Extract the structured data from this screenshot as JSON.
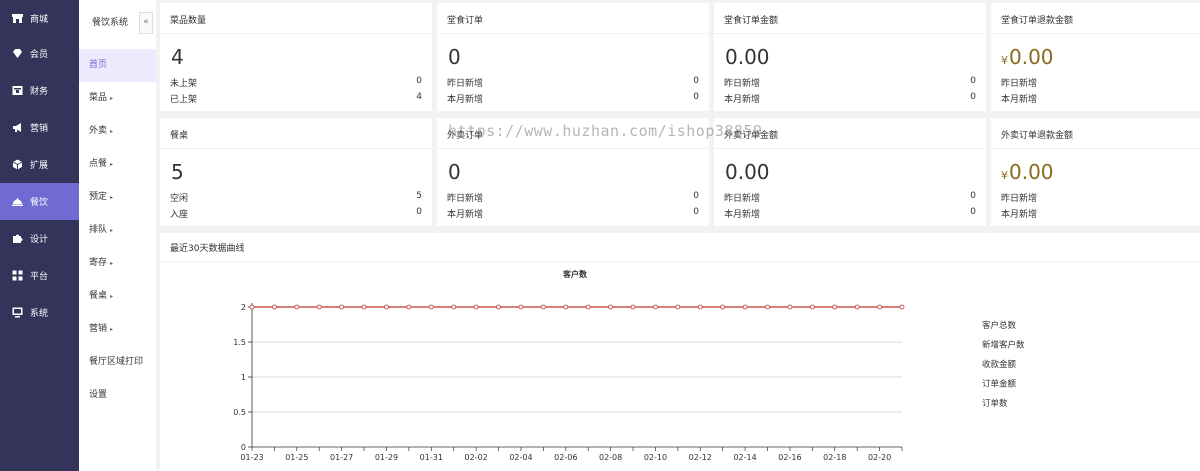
{
  "sidebar": {
    "items": [
      {
        "label": "商城",
        "icon": "store-icon"
      },
      {
        "label": "会员",
        "icon": "member-icon"
      },
      {
        "label": "财务",
        "icon": "finance-icon"
      },
      {
        "label": "营销",
        "icon": "megaphone-icon"
      },
      {
        "label": "扩展",
        "icon": "cube-icon"
      },
      {
        "label": "餐饮",
        "icon": "dish-cover-icon",
        "active": true
      },
      {
        "label": "设计",
        "icon": "puzzle-icon"
      },
      {
        "label": "平台",
        "icon": "grid-icon"
      },
      {
        "label": "系统",
        "icon": "monitor-icon"
      }
    ]
  },
  "submenu": {
    "title": "餐饮系统",
    "collapse": "«",
    "items": [
      {
        "label": "首页",
        "arrow": ""
      },
      {
        "label": "菜品",
        "arrow": "▸"
      },
      {
        "label": "外卖",
        "arrow": "▸"
      },
      {
        "label": "点餐",
        "arrow": "▸"
      },
      {
        "label": "预定",
        "arrow": "▸"
      },
      {
        "label": "排队",
        "arrow": "▸"
      },
      {
        "label": "寄存",
        "arrow": "▸"
      },
      {
        "label": "餐桌",
        "arrow": "▸"
      },
      {
        "label": "营销",
        "arrow": "▸"
      },
      {
        "label": "餐厅区域打印",
        "arrow": ""
      },
      {
        "label": "设置",
        "arrow": ""
      }
    ]
  },
  "cards": [
    {
      "title": "菜品数量",
      "value": "4",
      "currency": "",
      "rows": [
        {
          "label": "未上架",
          "value": "0"
        },
        {
          "label": "已上架",
          "value": "4"
        }
      ]
    },
    {
      "title": "堂食订单",
      "value": "0",
      "currency": "",
      "rows": [
        {
          "label": "昨日新增",
          "value": "0"
        },
        {
          "label": "本月新增",
          "value": "0"
        }
      ]
    },
    {
      "title": "堂食订单金额",
      "value": "0.00",
      "currency": "",
      "rows": [
        {
          "label": "昨日新增",
          "value": "0"
        },
        {
          "label": "本月新增",
          "value": "0"
        }
      ]
    },
    {
      "title": "堂食订单退款金额",
      "value": "0.00",
      "currency": "¥",
      "rows": [
        {
          "label": "昨日新增",
          "value": ""
        },
        {
          "label": "本月新增",
          "value": ""
        }
      ]
    },
    {
      "title": "餐桌",
      "value": "5",
      "currency": "",
      "rows": [
        {
          "label": "空闲",
          "value": "5"
        },
        {
          "label": "入座",
          "value": "0"
        }
      ]
    },
    {
      "title": "外卖订单",
      "value": "0",
      "currency": "",
      "rows": [
        {
          "label": "昨日新增",
          "value": "0"
        },
        {
          "label": "本月新增",
          "value": "0"
        }
      ]
    },
    {
      "title": "外卖订单金额",
      "value": "0.00",
      "currency": "",
      "rows": [
        {
          "label": "昨日新增",
          "value": "0"
        },
        {
          "label": "本月新增",
          "value": "0"
        }
      ]
    },
    {
      "title": "外卖订单退款金额",
      "value": "0.00",
      "currency": "¥",
      "rows": [
        {
          "label": "昨日新增",
          "value": ""
        },
        {
          "label": "本月新增",
          "value": ""
        }
      ]
    }
  ],
  "watermark": "https://www.huzhan.com/ishop38859",
  "chart_panel": {
    "title": "最近30天数据曲线"
  },
  "chart_data": {
    "type": "line",
    "title": "客户数",
    "x": [
      "01-23",
      "01-24",
      "01-25",
      "01-26",
      "01-27",
      "01-28",
      "01-29",
      "01-30",
      "01-31",
      "02-01",
      "02-02",
      "02-03",
      "02-04",
      "02-05",
      "02-06",
      "02-07",
      "02-08",
      "02-09",
      "02-10",
      "02-11",
      "02-12",
      "02-13",
      "02-14",
      "02-15",
      "02-16",
      "02-17",
      "02-18",
      "02-19",
      "02-20",
      "02-21"
    ],
    "x_tick_labels": [
      "01-23",
      "01-25",
      "01-27",
      "01-29",
      "01-31",
      "02-02",
      "02-04",
      "02-06",
      "02-08",
      "02-10",
      "02-12",
      "02-14",
      "02-16",
      "02-18",
      "02-20"
    ],
    "yticks": [
      "0",
      "0.5",
      "1",
      "1.5",
      "2"
    ],
    "ylim": [
      0,
      2
    ],
    "grid": true,
    "series": [
      {
        "name": "客户总数",
        "values": [
          2,
          2,
          2,
          2,
          2,
          2,
          2,
          2,
          2,
          2,
          2,
          2,
          2,
          2,
          2,
          2,
          2,
          2,
          2,
          2,
          2,
          2,
          2,
          2,
          2,
          2,
          2,
          2,
          2,
          2
        ]
      }
    ],
    "legend": [
      "客户总数",
      "新增客户数",
      "收款金额",
      "订单金额",
      "订单数"
    ],
    "legend_position": "right",
    "colors": {
      "line": "#c23531",
      "marker_fill": "#ffffff",
      "axis": "#333333",
      "grid": "#cccccc"
    }
  }
}
